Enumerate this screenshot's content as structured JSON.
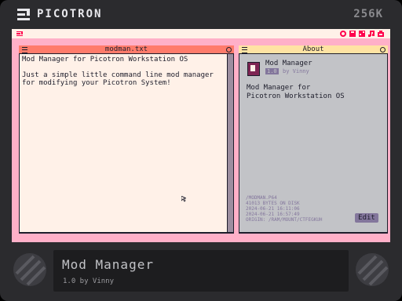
{
  "device": {
    "brand": "PICOTRON",
    "memory": "256K"
  },
  "editor": {
    "title": "modman.txt",
    "content": "Mod Manager for Picotron Workstation OS\n\nJust a simple little command line mod manager\nfor modifying your Picotron System!"
  },
  "about": {
    "title": "About",
    "app_name": "Mod Manager",
    "version": "1.0",
    "author": "by Vinny",
    "description": "Mod Manager for\nPicotron Workstation OS",
    "meta": "/MODMAN.P64\n41013 BYTES ON DISK\n2024-06-21 16:11:06\n2024-06-21 16:57:49\nORIGIN: /RAM/MOUNT/CTFEGKUH",
    "edit_label": "Edit"
  },
  "info": {
    "title": "Mod Manager",
    "subtitle": "1.0 by Vinny"
  },
  "colors": {
    "desktop": "#ffb0c8",
    "editor_titlebar": "#ff7b6b",
    "about_titlebar": "#ffe3a3",
    "panel": "#c2c3c7",
    "accent": "#83769c"
  },
  "icons": {
    "tray": [
      "record-icon",
      "save-icon",
      "files-icon",
      "music-icon",
      "app-icon"
    ]
  }
}
